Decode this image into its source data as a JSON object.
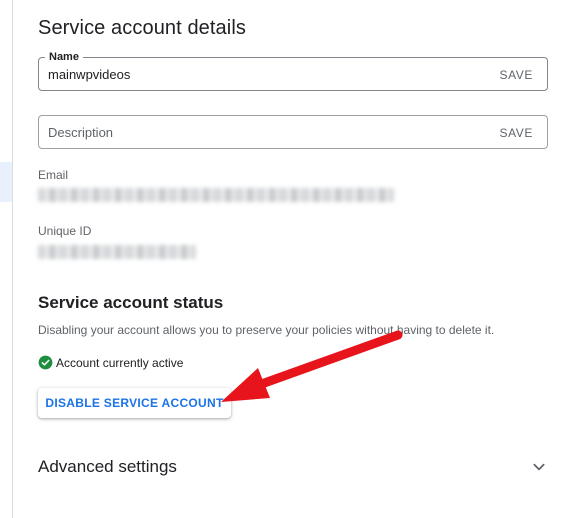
{
  "section_title": "Service account details",
  "name_field": {
    "label": "Name",
    "value": "mainwpvideos",
    "save_label": "SAVE"
  },
  "description_field": {
    "placeholder": "Description",
    "save_label": "SAVE"
  },
  "email": {
    "label": "Email"
  },
  "unique_id": {
    "label": "Unique ID"
  },
  "status_section": {
    "title": "Service account status",
    "help_text": "Disabling your account allows you to preserve your policies without having to delete it.",
    "status_text": "Account currently active",
    "disable_button_label": "DISABLE SERVICE ACCOUNT"
  },
  "advanced": {
    "title": "Advanced settings"
  },
  "colors": {
    "accent": "#1a73e8",
    "active_green": "#1e8e3e",
    "annotation_arrow": "#e8141b"
  },
  "icons": {
    "status": "check-circle-icon",
    "expand": "chevron-down-icon"
  }
}
